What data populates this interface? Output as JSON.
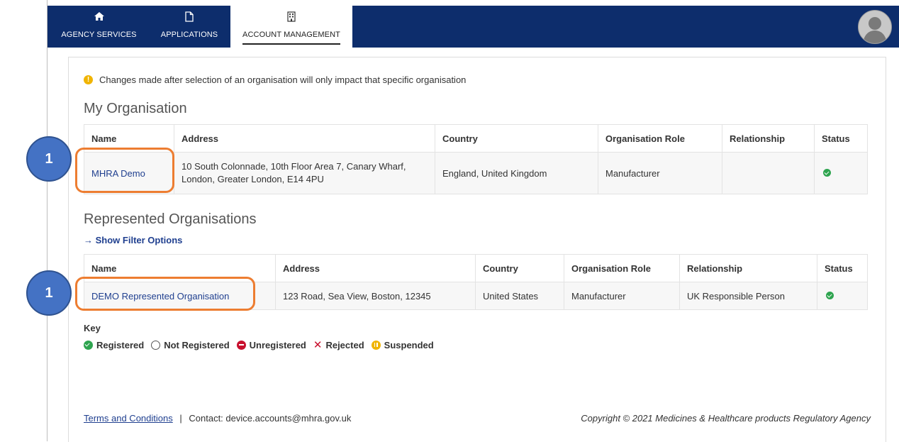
{
  "nav": {
    "items": [
      {
        "label": "AGENCY SERVICES",
        "icon": "home-icon"
      },
      {
        "label": "APPLICATIONS",
        "icon": "document-icon"
      },
      {
        "label": "ACCOUNT MANAGEMENT",
        "icon": "building-icon",
        "active": true
      }
    ],
    "avatar_icon": "user-avatar-icon"
  },
  "notice": "Changes made after selection of an organisation will only impact that specific organisation",
  "my_org": {
    "title": "My Organisation",
    "columns": [
      "Name",
      "Address",
      "Country",
      "Organisation Role",
      "Relationship",
      "Status"
    ],
    "row": {
      "name": "MHRA Demo",
      "address": "10 South Colonnade, 10th Floor Area 7, Canary Wharf, London, Greater London, E14 4PU",
      "country": "England, United Kingdom",
      "role": "Manufacturer",
      "relationship": "",
      "status": "Registered"
    }
  },
  "represented": {
    "title": "Represented Organisations",
    "filter_link": "Show Filter Options",
    "columns": [
      "Name",
      "Address",
      "Country",
      "Organisation Role",
      "Relationship",
      "Status"
    ],
    "row": {
      "name": "DEMO Represented Organisation",
      "address": "123 Road, Sea View, Boston, 12345",
      "country": "United States",
      "role": "Manufacturer",
      "relationship": "UK Responsible Person",
      "status": "Registered"
    }
  },
  "key": {
    "title": "Key",
    "items": [
      "Registered",
      "Not Registered",
      "Unregistered",
      "Rejected",
      "Suspended"
    ]
  },
  "footer": {
    "terms": "Terms and Conditions",
    "separator": "|",
    "contact": "Contact: device.accounts@mhra.gov.uk",
    "copyright": "Copyright © 2021 Medicines & Healthcare products Regulatory Agency"
  },
  "callouts": [
    "1",
    "1"
  ],
  "colors": {
    "navbar": "#0d2d6c",
    "link": "#1f3f8f",
    "callout": "#4472c4",
    "highlight": "#ed7d31",
    "status_ok": "#2ea44f"
  }
}
